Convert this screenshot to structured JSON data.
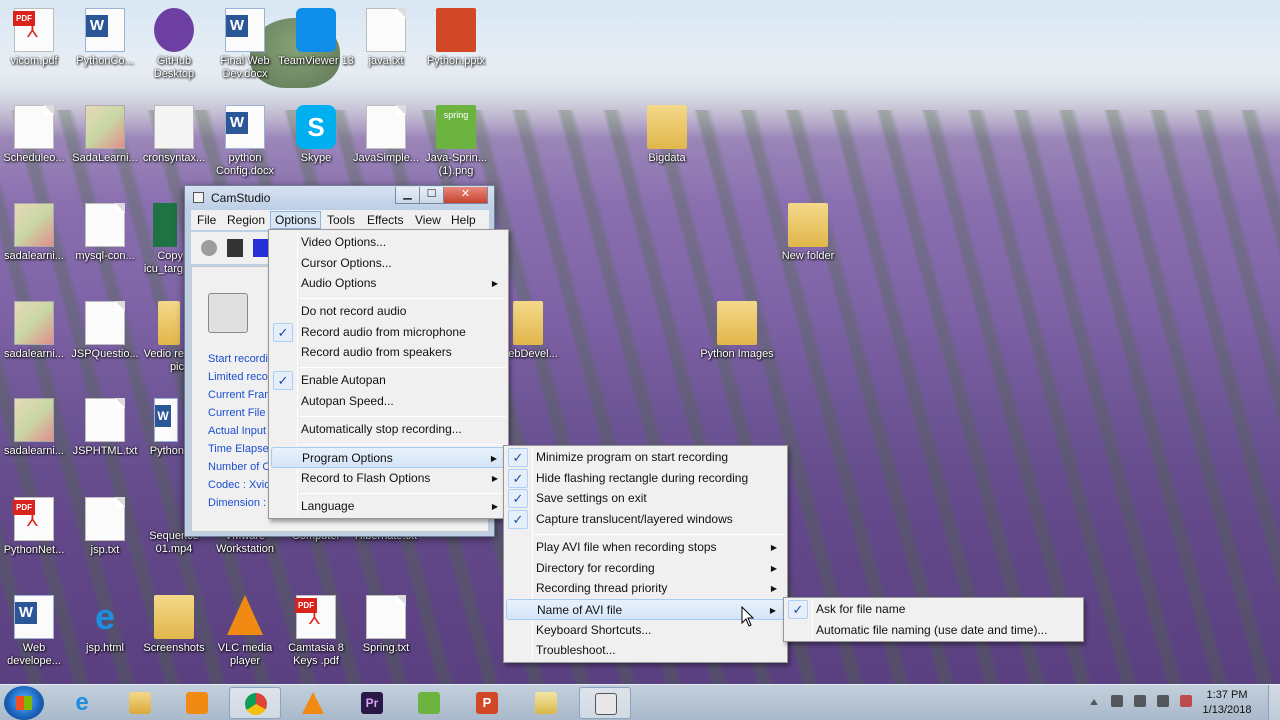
{
  "desktop": {
    "icons": [
      {
        "label": "vicom.pdf",
        "icon": "pdf-icon"
      },
      {
        "label": "PythonCo...",
        "icon": "word-doc-icon"
      },
      {
        "label": "GitHub Desktop",
        "icon": "github-icon"
      },
      {
        "label": "Final Web Dev.docx",
        "icon": "word-doc-icon"
      },
      {
        "label": "TeamViewer 13",
        "icon": "teamviewer-icon"
      },
      {
        "label": "java.txt",
        "icon": "text-file-icon"
      },
      {
        "label": "Python.pptx",
        "icon": "powerpoint-icon"
      },
      {
        "label": "Scheduleo...",
        "icon": "text-file-icon"
      },
      {
        "label": "SadaLearni...",
        "icon": "image-file-icon"
      },
      {
        "label": "cronsyntax...",
        "icon": "image-file-icon"
      },
      {
        "label": "python Config.docx",
        "icon": "word-doc-icon"
      },
      {
        "label": "Skype",
        "icon": "skype-icon"
      },
      {
        "label": "JavaSimple...",
        "icon": "text-file-icon"
      },
      {
        "label": "Java-Sprin... (1).png",
        "icon": "spring-image-icon"
      },
      {
        "label": "Bigdata",
        "icon": "folder-icon"
      },
      {
        "label": "sadalearni...",
        "icon": "image-file-icon"
      },
      {
        "label": "mysql-con...",
        "icon": "config-file-icon"
      },
      {
        "label": "Copy icu_targ",
        "icon": "excel-icon"
      },
      {
        "label": "New folder",
        "icon": "folder-icon"
      },
      {
        "label": "sadalearni...",
        "icon": "image-file-icon"
      },
      {
        "label": "JSPQuestio...",
        "icon": "text-file-icon"
      },
      {
        "label": "Vedio re pic",
        "icon": "folder-icon"
      },
      {
        "label": "ebDevel...",
        "icon": "folder-icon"
      },
      {
        "label": "Python Images",
        "icon": "folder-icon"
      },
      {
        "label": "sadalearni...",
        "icon": "image-file-icon"
      },
      {
        "label": "JSPHTML.txt",
        "icon": "text-file-icon"
      },
      {
        "label": "Python",
        "icon": "word-doc-icon"
      },
      {
        "label": "PythonNet...",
        "icon": "pdf-icon"
      },
      {
        "label": "jsp.txt",
        "icon": "text-file-icon"
      },
      {
        "label": "Sequence 01.mp4",
        "icon": "video-file-icon"
      },
      {
        "label": "VMware Workstation",
        "icon": "vmware-icon"
      },
      {
        "label": "Computer",
        "icon": "computer-icon"
      },
      {
        "label": "Hibernate.txt",
        "icon": "text-file-icon"
      },
      {
        "label": "Web develope...",
        "icon": "word-doc-icon"
      },
      {
        "label": "jsp.html",
        "icon": "internet-explorer-icon"
      },
      {
        "label": "Screenshots",
        "icon": "folder-icon"
      },
      {
        "label": "VLC media player",
        "icon": "vlc-icon"
      },
      {
        "label": "Camtasia 8 Keys .pdf",
        "icon": "pdf-icon"
      },
      {
        "label": "Spring.txt",
        "icon": "text-file-icon"
      }
    ]
  },
  "camstudio": {
    "title": "CamStudio",
    "menubar": [
      "File",
      "Region",
      "Options",
      "Tools",
      "Effects",
      "View",
      "Help"
    ],
    "active_menu": "Options",
    "stats": [
      "Start recording",
      "Limited record",
      "Current Frame",
      "Current File Si",
      "Actual Input F",
      "Time Elapsed",
      "Number of Co",
      "Codec : Xvid",
      "Dimension : 1"
    ]
  },
  "options_menu": [
    {
      "label": "Video Options...",
      "checked": false,
      "submenu": false
    },
    {
      "label": "Cursor Options...",
      "checked": false,
      "submenu": false
    },
    {
      "label": "Audio Options",
      "checked": false,
      "submenu": true
    },
    {
      "label": "Do not record audio",
      "checked": false,
      "submenu": false
    },
    {
      "label": "Record audio from microphone",
      "checked": true,
      "submenu": false
    },
    {
      "label": "Record audio from speakers",
      "checked": false,
      "submenu": false
    },
    {
      "label": "Enable Autopan",
      "checked": true,
      "submenu": false
    },
    {
      "label": "Autopan Speed...",
      "checked": false,
      "submenu": false
    },
    {
      "label": "Automatically stop recording...",
      "checked": false,
      "submenu": false
    },
    {
      "label": "Program Options",
      "checked": false,
      "submenu": true,
      "highlighted": true
    },
    {
      "label": "Record to Flash Options",
      "checked": false,
      "submenu": true
    },
    {
      "label": "Language",
      "checked": false,
      "submenu": true
    }
  ],
  "program_options_menu": [
    {
      "label": "Minimize program on start recording",
      "checked": true,
      "submenu": false
    },
    {
      "label": "Hide flashing rectangle during recording",
      "checked": true,
      "submenu": false
    },
    {
      "label": "Save settings on exit",
      "checked": true,
      "submenu": false
    },
    {
      "label": "Capture translucent/layered windows",
      "checked": true,
      "submenu": false
    },
    {
      "label": "Play AVI file when recording stops",
      "checked": false,
      "submenu": true
    },
    {
      "label": "Directory for recording",
      "checked": false,
      "submenu": true
    },
    {
      "label": "Recording thread priority",
      "checked": false,
      "submenu": true
    },
    {
      "label": "Name of AVI file",
      "checked": false,
      "submenu": true,
      "highlighted": true
    },
    {
      "label": "Keyboard Shortcuts...",
      "checked": false,
      "submenu": false
    },
    {
      "label": "Troubleshoot...",
      "checked": false,
      "submenu": false
    }
  ],
  "avi_name_menu": [
    {
      "label": "Ask for file name",
      "checked": true
    },
    {
      "label": "Automatic file naming (use date and time)...",
      "checked": false
    }
  ],
  "taskbar": {
    "apps": [
      "internet-explorer",
      "file-explorer",
      "media-player",
      "chrome",
      "vlc",
      "premiere",
      "excel",
      "powerpoint",
      "folder",
      "camstudio"
    ],
    "clock_time": "1:37 PM",
    "clock_date": "1/13/2018"
  },
  "glyphs": {
    "check": "✓",
    "arrow": "▶"
  }
}
